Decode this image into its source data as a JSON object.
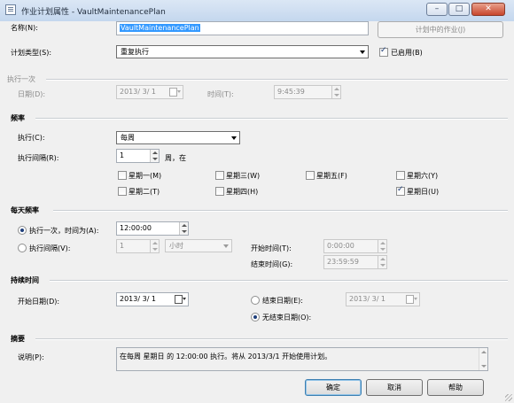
{
  "window": {
    "title": "作业计划属性 - VaultMaintenancePlan",
    "min": "–",
    "max": "□",
    "close": "✕"
  },
  "name_row": {
    "label": "名称(N):",
    "value": "VaultMaintenancePlan",
    "jobs_button": "计划中的作业(J)"
  },
  "schedule_type": {
    "label": "计划类型(S):",
    "value": "重复执行",
    "enabled_label": "已启用(B)",
    "enabled": true
  },
  "one_time": {
    "header": "执行一次",
    "date_label": "日期(D):",
    "date_value": "2013/ 3/ 1",
    "time_label": "时间(T):",
    "time_value": "9:45:39"
  },
  "frequency": {
    "header": "频率",
    "occurs_label": "执行(C):",
    "occurs_value": "每周",
    "recurs_label": "执行间隔(R):",
    "recurs_value": "1",
    "recurs_unit": "周，在",
    "days": [
      {
        "label": "星期一(M)",
        "checked": false
      },
      {
        "label": "星期三(W)",
        "checked": false
      },
      {
        "label": "星期五(F)",
        "checked": false
      },
      {
        "label": "星期六(Y)",
        "checked": false
      },
      {
        "label": "星期二(T)",
        "checked": false
      },
      {
        "label": "星期四(H)",
        "checked": false
      },
      {
        "label": "星期日(U)",
        "checked": true
      }
    ]
  },
  "daily": {
    "header": "每天频率",
    "once_label": "执行一次，时间为(A):",
    "once_value": "12:00:00",
    "once_checked": true,
    "every_label": "执行间隔(V):",
    "every_value": "1",
    "every_unit": "小时",
    "every_checked": false,
    "start_label": "开始时间(T):",
    "start_value": "0:00:00",
    "end_label": "结束时间(G):",
    "end_value": "23:59:59"
  },
  "duration": {
    "header": "持续时间",
    "start_label": "开始日期(D):",
    "start_value": "2013/ 3/ 1",
    "end_label": "结束日期(E):",
    "end_value": "2013/ 3/ 1",
    "end_checked": false,
    "noend_label": "无结束日期(O):",
    "noend_checked": true
  },
  "summary": {
    "header": "摘要",
    "desc_label": "说明(P):",
    "desc_value": "在每周 星期日 的 12:00:00 执行。将从 2013/3/1 开始使用计划。"
  },
  "buttons": {
    "ok": "确定",
    "cancel": "取消",
    "help": "帮助"
  },
  "colors": {
    "selection": "#3399ff",
    "title_bar": "#c4d7ee",
    "close_button": "#c8462c"
  }
}
